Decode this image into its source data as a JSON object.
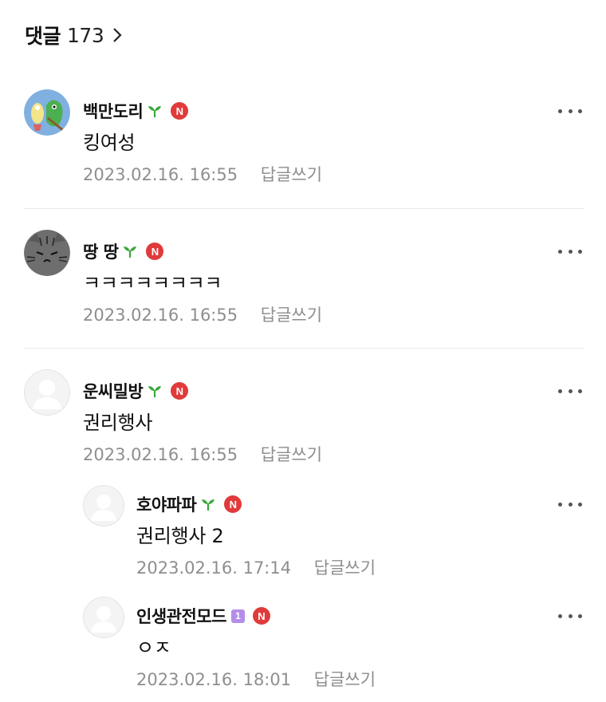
{
  "header": {
    "title": "댓글",
    "count": "173"
  },
  "comments": [
    {
      "author": "백만도리",
      "text": "킹여성",
      "time": "2023.02.16. 16:55",
      "reply_label": "답글쓰기",
      "badge": "N"
    },
    {
      "author": "땅 땅",
      "text": "ㅋㅋㅋㅋㅋㅋㅋㅋ",
      "time": "2023.02.16. 16:55",
      "reply_label": "답글쓰기",
      "badge": "N"
    },
    {
      "author": "운씨밀방",
      "text": "권리행사",
      "time": "2023.02.16. 16:55",
      "reply_label": "답글쓰기",
      "badge": "N"
    }
  ],
  "replies": [
    {
      "author": "호야파파",
      "text": "권리행사 2",
      "time": "2023.02.16. 17:14",
      "reply_label": "답글쓰기",
      "badge": "N"
    },
    {
      "author": "인생관전모드",
      "text": "ㅇㅈ",
      "time": "2023.02.16. 18:01",
      "reply_label": "답글쓰기",
      "badge": "N",
      "level": "1"
    }
  ],
  "colors": {
    "badge_red": "#e03a3a",
    "sprout_green": "#3aa83a",
    "meta_gray": "#8e8e8e",
    "level_purple": "#b48de8"
  }
}
